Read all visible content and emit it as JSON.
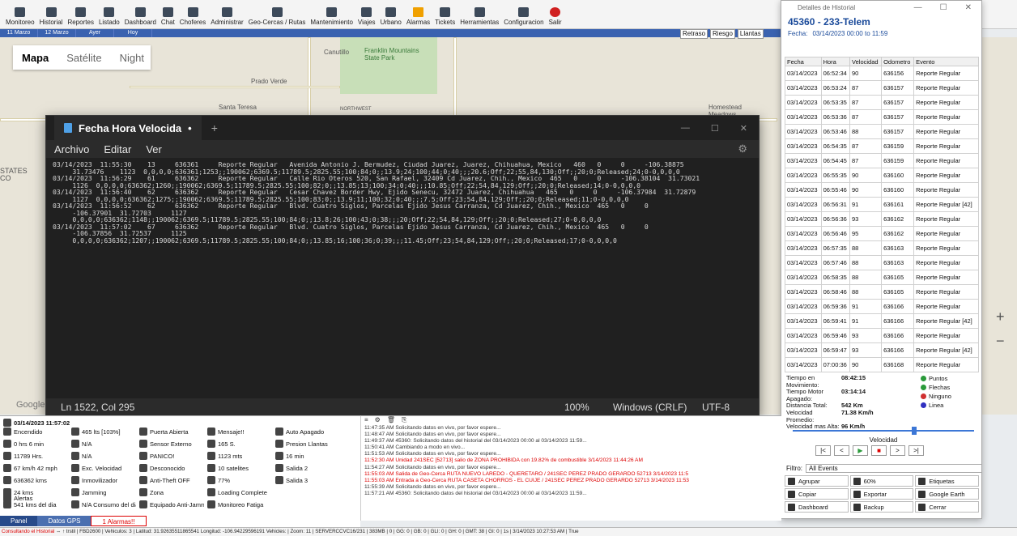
{
  "toolbar": {
    "items": [
      "Monitoreo",
      "Historial",
      "Reportes",
      "Listado",
      "Dashboard",
      "Chat",
      "Choferes",
      "Administrar",
      "Geo-Cercas / Rutas",
      "Mantenimiento",
      "Viajes",
      "Urbano",
      "Alarmas",
      "Tickets",
      "Herramientas",
      "Configuracion",
      "Salir"
    ]
  },
  "datebar": [
    "11 Marzo",
    "12 Marzo",
    "Ayer",
    "Hoy"
  ],
  "map": {
    "switch": [
      "Mapa",
      "Satélite",
      "Night"
    ],
    "labels": [
      "Canutillo",
      "Franklin Mountains State Park",
      "Prado Verde",
      "Santa Teresa",
      "NORTHWEST",
      "Homestead Meadows",
      "STATES",
      "CO",
      "Google",
      "375",
      "178",
      "136",
      "54"
    ],
    "risk": [
      "Retraso",
      "Riesgo",
      "Llantas"
    ]
  },
  "notepad": {
    "tab": "Fecha Hora Velocida",
    "menu": [
      "Archivo",
      "Editar",
      "Ver"
    ],
    "lines": [
      "03/14/2023  11:55:30    13     636361     Reporte Regular   Avenida Antonio J. Bermudez, Ciudad Juarez, Juarez, Chihuahua, Mexico   460   0     0     -106.38875",
      "     31.73476    1123  0,0,0,0;636361;1253;;190062;6369.5;11789.5;2825.55;100;84;0;;13.9;24;100;44;0;40;;;20.6;Off;22;55,84,130;Off;;20;0;Released;24;0-0,0,0,0",
      "03/14/2023  11:56:29    61     636362     Reporte Regular   Calle Rio Oteros 520, San Rafael, 32409 Cd Juarez, Chih., Mexico  465   0     0     -106.38104  31.73021",
      "     1126  0,0,0,0;636362;1260;;190062;6369.5;11789.5;2825.55;100;82;0;;13.85;13;100;34;0;40;;;10.85;Off;22;54,84,129;Off;;20;0;Released;14;0-0,0,0,0",
      "03/14/2023  11:56:40    62     636362     Reporte Regular   Cesar Chavez Border Hwy, Ejido Senecu, 32472 Juarez, Chihuahua   465   0     0     -106.37984  31.72879",
      "     1127  0,0,0,0;636362;1275;;190062;6369.5;11789.5;2825.55;100;83;0;;13.9;11;100;32;0;40;;;7.5;Off;23;54,84,129;Off;;20;0;Released;11;0-0,0,0,0",
      "03/14/2023  11:56:52    62     636362     Reporte Regular   Blvd. Cuatro Siglos, Parcelas Ejido Jesus Carranza, Cd Juarez, Chih., Mexico  465   0     0",
      "     -106.37901  31.72703     1127",
      "     0,0,0,0;636362;1148;;190062;6369.5;11789.5;2825.55;100;84;0;;13.8;26;100;43;0;38;;;20;Off;22;54,84,129;Off;;20;0;Released;27;0-0,0,0,0",
      "03/14/2023  11:57:02    67     636362     Reporte Regular   Blvd. Cuatro Siglos, Parcelas Ejido Jesus Carranza, Cd Juarez, Chih., Mexico  465   0     0",
      "     -106.37856  31.72537     1125",
      "     0,0,0,0;636362;1207;;190062;6369.5;11789.5;2825.55;100;84;0;;13.85;16;100;36;0;39;;;11.45;Off;23;54,84,129;Off;;20;0;Released;17;0-0,0,0,0"
    ],
    "status": {
      "pos": "Ln 1522, Col 295",
      "zoom": "100%",
      "eol": "Windows (CRLF)",
      "enc": "UTF-8"
    }
  },
  "history": {
    "window_title": "Detalles de Historial",
    "vehicle": "45360 - 233-Telem",
    "fecha_label": "Fecha:",
    "fecha_value": "03/14/2023 00:00 to 11:59",
    "columns": [
      "Fecha",
      "Hora",
      "Velocidad",
      "Odometro",
      "Evento"
    ],
    "rows": [
      [
        "03/14/2023",
        "06:52:34",
        "90",
        "636156",
        "Reporte Regular"
      ],
      [
        "03/14/2023",
        "06:53:24",
        "87",
        "636157",
        "Reporte Regular"
      ],
      [
        "03/14/2023",
        "06:53:35",
        "87",
        "636157",
        "Reporte Regular"
      ],
      [
        "03/14/2023",
        "06:53:36",
        "87",
        "636157",
        "Reporte Regular"
      ],
      [
        "03/14/2023",
        "06:53:46",
        "88",
        "636157",
        "Reporte Regular"
      ],
      [
        "03/14/2023",
        "06:54:35",
        "87",
        "636159",
        "Reporte Regular"
      ],
      [
        "03/14/2023",
        "06:54:45",
        "87",
        "636159",
        "Reporte Regular"
      ],
      [
        "03/14/2023",
        "06:55:35",
        "90",
        "636160",
        "Reporte Regular"
      ],
      [
        "03/14/2023",
        "06:55:46",
        "90",
        "636160",
        "Reporte Regular"
      ],
      [
        "03/14/2023",
        "06:56:31",
        "91",
        "636161",
        "Reporte Regular [42]"
      ],
      [
        "03/14/2023",
        "06:56:36",
        "93",
        "636162",
        "Reporte Regular"
      ],
      [
        "03/14/2023",
        "06:56:46",
        "95",
        "636162",
        "Reporte Regular"
      ],
      [
        "03/14/2023",
        "06:57:35",
        "88",
        "636163",
        "Reporte Regular"
      ],
      [
        "03/14/2023",
        "06:57:46",
        "88",
        "636163",
        "Reporte Regular"
      ],
      [
        "03/14/2023",
        "06:58:35",
        "88",
        "636165",
        "Reporte Regular"
      ],
      [
        "03/14/2023",
        "06:58:46",
        "88",
        "636165",
        "Reporte Regular"
      ],
      [
        "03/14/2023",
        "06:59:36",
        "91",
        "636166",
        "Reporte Regular"
      ],
      [
        "03/14/2023",
        "06:59:41",
        "91",
        "636166",
        "Reporte Regular [42]"
      ],
      [
        "03/14/2023",
        "06:59:46",
        "93",
        "636166",
        "Reporte Regular"
      ],
      [
        "03/14/2023",
        "06:59:47",
        "93",
        "636166",
        "Reporte Regular [42]"
      ],
      [
        "03/14/2023",
        "07:00:36",
        "90",
        "636168",
        "Reporte Regular"
      ]
    ],
    "stats": [
      [
        "Tiempo en Movimiento:",
        "08:42:15"
      ],
      [
        "Tiempo Motor Apagado:",
        "03:14:14"
      ],
      [
        "Distancia Total:",
        "542 Km"
      ],
      [
        "Velocidad Promedio:",
        "71.38 Km/h"
      ],
      [
        "Velocidad mas Alta:",
        "96 Km/h"
      ]
    ],
    "opts": [
      "Puntos",
      "Flechas",
      "Ninguno",
      "Linea"
    ],
    "velocidad": "Velocidad",
    "velocidad_level": 0.7,
    "filtro_label": "Filtro:",
    "filtro_value": "All Events",
    "buttons": [
      "Agrupar",
      "60%",
      "Etiquetas",
      "Copiar",
      "Exportar",
      "Google Earth",
      "Dashboard",
      "Backup",
      "Cerrar"
    ]
  },
  "status": {
    "date": "03/14/2023 11:57:02",
    "cells": [
      "Encendido",
      "0 hrs 6 min",
      "11789 Hrs.",
      "67 km/h  42 mph",
      "636362 kms",
      "24 kms",
      "541 kms del dia",
      "465 lts [103%]",
      "N/A",
      "N/A",
      "Exc. Velocidad",
      "Inmovilizador",
      "Jamming",
      "N/A Consumo del dia",
      "Puerta Abierta",
      "Sensor Externo",
      "PANICO!",
      "Desconocido",
      "Anti-Theft OFF",
      "Zona",
      "Equipado Anti-Jammer Equipado Anti-Asalto",
      "Mensaje!!",
      "165 S.",
      "1123 mts",
      "10 satelites",
      "77%",
      "Loading Complete",
      "Monitoreo Fatiga",
      "Auto Apagado",
      "Presion Llantas",
      "16 min",
      "Salida 2",
      "Salida 3"
    ],
    "alertas": "Alertas",
    "tabs": [
      "Panel",
      "Datos GPS",
      "1 Alarmas!!"
    ]
  },
  "log": {
    "lines": [
      "11:47:35 AM  Solicitando datos en vivo, por favor espere...",
      "11:48:47 AM  Solicitando datos en vivo, por favor espere...",
      "11:49:37 AM  45360: Solicitando datos del historial del 03/14/2023 00:00 al 03/14/2023 11:59...",
      "11:50:41 AM  Cambiando a modo en vivo...",
      "11:51:53 AM  Solicitando datos en vivo, por favor espere...",
      "11:52:30 AM  Unidad 241SEC [52713] salio de ZONA PROHIBIDA con 19.82% de combustible 3/14/2023 11:44:26 AM",
      "11:54:27 AM  Solicitando datos en vivo, por favor espere...",
      "11:55:03 AM  Salida de Geo-Cerca RUTA NUEVO LAREDO - QUERETARO / 241SEC PEREZ PRADO GERARDO  52713 3/14/2023 11:5",
      "11:55:03 AM  Entrada a Geo-Cerca RUTA CASETA CHORROS - EL CUIJE / 241SEC PEREZ PRADO GERARDO  52713 3/14/2023 11:53",
      "11:55:39 AM  Solicitando datos en vivo, por favor espere...",
      "11:57:21 AM  45360: Solicitando datos del historial del 03/14/2023 00:00 al 03/14/2023 11:59..."
    ]
  },
  "bottombar": {
    "hl": "Consultando el Historial",
    "rest": "  ⇔   ↑  trstil  | FBD2600 | Vehiculos: 3 | Latitud: 31.92635511865541 Longitud: -106.94229596191 Vehicles: | Zoom: 11 | SERVERCCVC16/231 | 383MB | 0 | GG: 0 | GB: 0 | GLI: 0 | GH: 0 | GMT: 38 | GI: 0 | 1s | 3/14/2023 10:27:53 AM | True"
  },
  "colors": {
    "accent": "#3a62b0",
    "notepad_bg": "#202020",
    "history_title": "#1a4a9a",
    "alert": "#dd0000"
  }
}
